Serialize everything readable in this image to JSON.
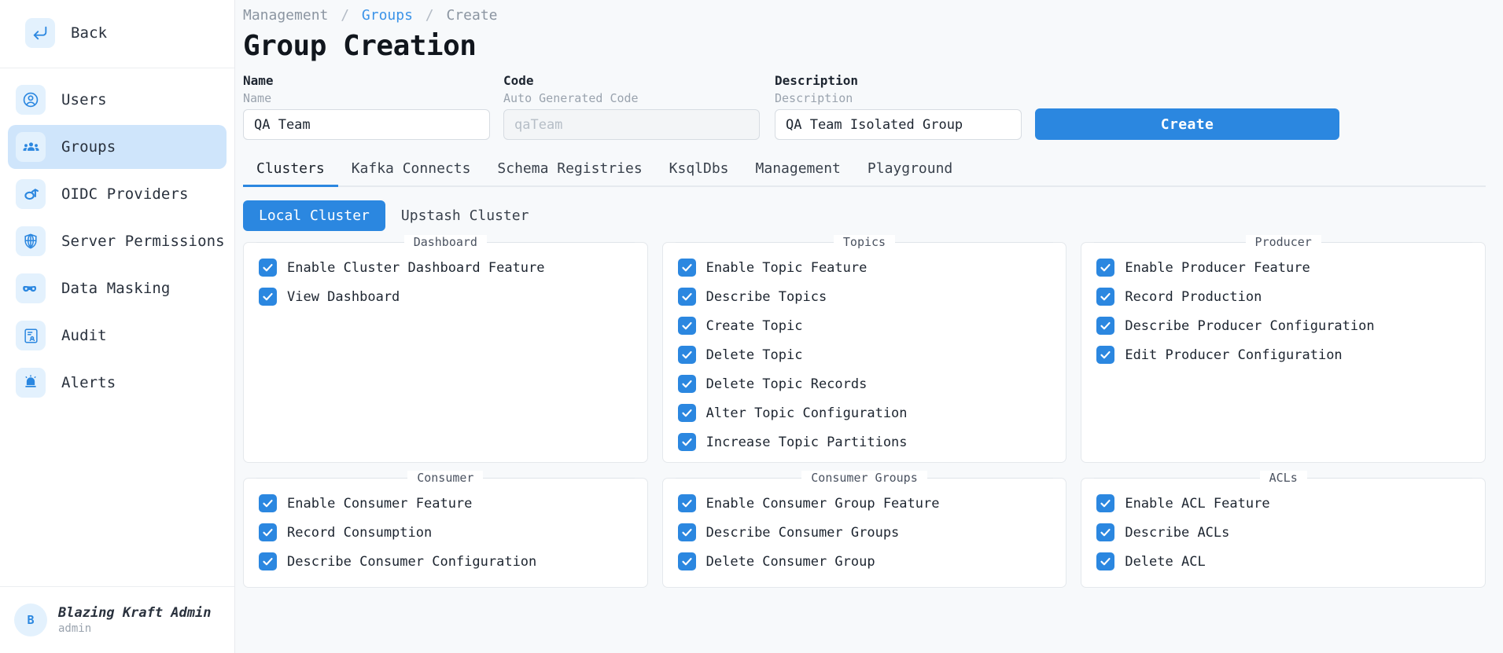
{
  "sidebar": {
    "back": {
      "label": "Back",
      "icon": "back-arrow-icon"
    },
    "items": [
      {
        "label": "Users",
        "icon": "user-circle-icon",
        "active": false
      },
      {
        "label": "Groups",
        "icon": "groups-icon",
        "active": true
      },
      {
        "label": "OIDC Providers",
        "icon": "oidc-icon",
        "active": false
      },
      {
        "label": "Server Permissions",
        "icon": "shield-globe-icon",
        "active": false
      },
      {
        "label": "Data Masking",
        "icon": "mask-icon",
        "active": false
      },
      {
        "label": "Audit",
        "icon": "audit-document-icon",
        "active": false
      },
      {
        "label": "Alerts",
        "icon": "alert-bell-icon",
        "active": false
      }
    ],
    "user": {
      "initial": "B",
      "name": "Blazing Kraft Admin",
      "role": "admin"
    }
  },
  "breadcrumb": {
    "root": "Management",
    "link": "Groups",
    "current": "Create",
    "separator": "/"
  },
  "page_title": "Group Creation",
  "form": {
    "name": {
      "label": "Name",
      "sublabel": "Name",
      "value": "QA Team",
      "placeholder": "Name"
    },
    "code": {
      "label": "Code",
      "sublabel": "Auto Generated Code",
      "value": "",
      "placeholder": "qaTeam"
    },
    "description": {
      "label": "Description",
      "sublabel": "Description",
      "value": "QA Team Isolated Group",
      "placeholder": "Description"
    },
    "submit_label": "Create"
  },
  "tabs": [
    {
      "label": "Clusters",
      "active": true
    },
    {
      "label": "Kafka Connects",
      "active": false
    },
    {
      "label": "Schema Registries",
      "active": false
    },
    {
      "label": "KsqlDbs",
      "active": false
    },
    {
      "label": "Management",
      "active": false
    },
    {
      "label": "Playground",
      "active": false
    }
  ],
  "clusters": [
    {
      "label": "Local Cluster",
      "active": true
    },
    {
      "label": "Upstash Cluster",
      "active": false
    }
  ],
  "panels": [
    {
      "title": "Dashboard",
      "items": [
        {
          "label": "Enable Cluster Dashboard Feature",
          "checked": true
        },
        {
          "label": "View Dashboard",
          "checked": true
        }
      ]
    },
    {
      "title": "Topics",
      "items": [
        {
          "label": "Enable Topic Feature",
          "checked": true
        },
        {
          "label": "Describe Topics",
          "checked": true
        },
        {
          "label": "Create Topic",
          "checked": true
        },
        {
          "label": "Delete Topic",
          "checked": true
        },
        {
          "label": "Delete Topic Records",
          "checked": true
        },
        {
          "label": "Alter Topic Configuration",
          "checked": true
        },
        {
          "label": "Increase Topic Partitions",
          "checked": true
        }
      ]
    },
    {
      "title": "Producer",
      "items": [
        {
          "label": "Enable Producer Feature",
          "checked": true
        },
        {
          "label": "Record Production",
          "checked": true
        },
        {
          "label": "Describe Producer Configuration",
          "checked": true
        },
        {
          "label": "Edit Producer Configuration",
          "checked": true
        }
      ]
    },
    {
      "title": "Consumer",
      "items": [
        {
          "label": "Enable Consumer Feature",
          "checked": true
        },
        {
          "label": "Record Consumption",
          "checked": true
        },
        {
          "label": "Describe Consumer Configuration",
          "checked": true
        }
      ]
    },
    {
      "title": "Consumer Groups",
      "items": [
        {
          "label": "Enable Consumer Group Feature",
          "checked": true
        },
        {
          "label": "Describe Consumer Groups",
          "checked": true
        },
        {
          "label": "Delete Consumer Group",
          "checked": true
        }
      ]
    },
    {
      "title": "ACLs",
      "items": [
        {
          "label": "Enable ACL Feature",
          "checked": true
        },
        {
          "label": "Describe ACLs",
          "checked": true
        },
        {
          "label": "Delete ACL",
          "checked": true
        }
      ]
    }
  ],
  "colors": {
    "accent": "#2b87e0",
    "sidebar_active": "#cfe5fb",
    "icon_bg": "#e3f1fd",
    "page_bg": "#f7f9fb",
    "text": "#1d2530",
    "muted": "#9aa3ae"
  }
}
